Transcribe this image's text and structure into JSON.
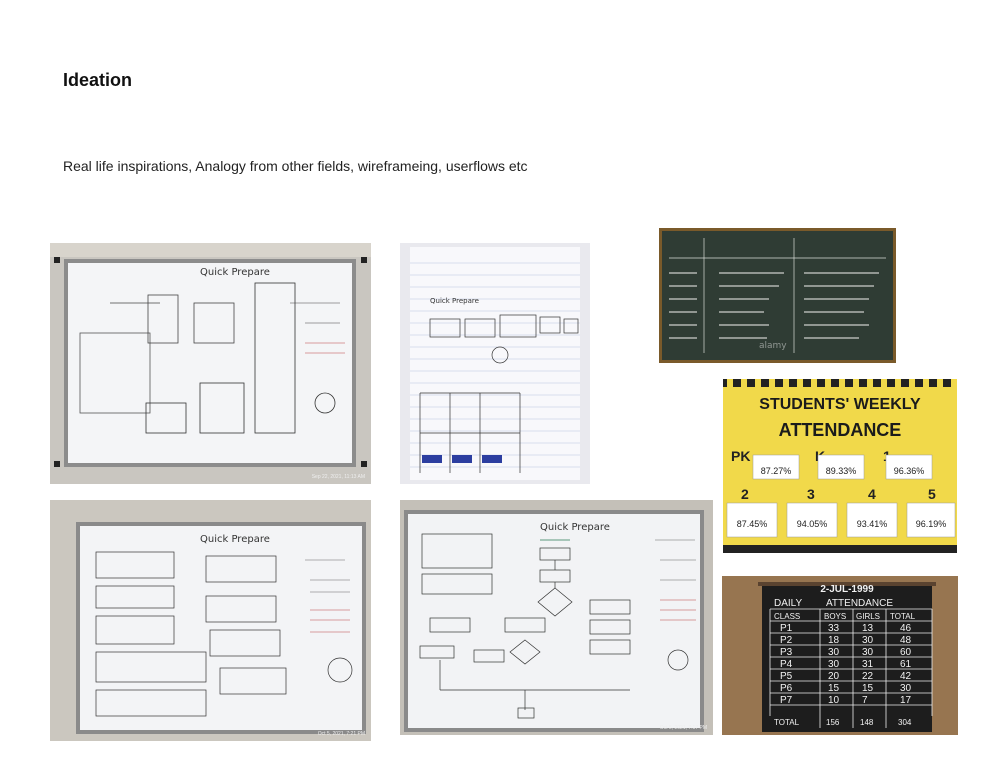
{
  "page": {
    "title": "Ideation",
    "subtitle": "Real life inspirations, Analogy from other fields, wireframeing, userflows etc"
  },
  "photos": {
    "board1": {
      "heading": "Quick Prepare",
      "timestamp": "Sep 22, 2021, 11:13 AM"
    },
    "notebook": {
      "heading": "Quick Prepare"
    },
    "board2": {
      "heading": "Quick Prepare",
      "timestamp": "Oct 5, 2021, 7:21 PM"
    },
    "board3": {
      "heading": "Quick Prepare",
      "timestamp": "Oct 5, 2021, 7:17 PM"
    },
    "chalkboard": {
      "watermark": "alamy"
    },
    "attendance_poster": {
      "title_line1": "STUDENTS' WEEKLY",
      "title_line2": "ATTENDANCE",
      "cells": [
        {
          "grade": "PK",
          "pct": "87.27%"
        },
        {
          "grade": "K",
          "pct": "89.33%"
        },
        {
          "grade": "1",
          "pct": "96.36%"
        },
        {
          "grade": "2",
          "pct": "87.45%"
        },
        {
          "grade": "3",
          "pct": "94.05%"
        },
        {
          "grade": "4",
          "pct": "93.41%"
        },
        {
          "grade": "5",
          "pct": "96.19%"
        }
      ]
    },
    "daily_board": {
      "date": "2-JUL-1999",
      "header_left": "DAILY",
      "header_right": "ATTENDANCE",
      "columns": [
        "CLASS",
        "BOYS",
        "GIRLS",
        "TOTAL"
      ],
      "rows": [
        [
          "P1",
          "33",
          "13",
          "46"
        ],
        [
          "P2",
          "18",
          "30",
          "48"
        ],
        [
          "P3",
          "30",
          "30",
          "60"
        ],
        [
          "P4",
          "30",
          "31",
          "61"
        ],
        [
          "P5",
          "20",
          "22",
          "42"
        ],
        [
          "P6",
          "15",
          "15",
          "30"
        ],
        [
          "P7",
          "10",
          "7",
          "17"
        ]
      ],
      "total_row": [
        "TOTAL",
        "156",
        "148",
        "304"
      ]
    }
  }
}
